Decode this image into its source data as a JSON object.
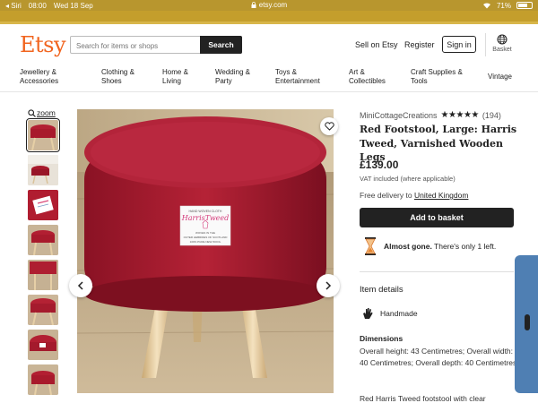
{
  "status": {
    "carrier": "◂ Siri",
    "time": "08:00",
    "date": "Wed 18 Sep",
    "url": "etsy.com",
    "battery": "71%",
    "battery_level": 0.71
  },
  "header": {
    "logo": "Etsy",
    "search_placeholder": "Search for items or shops",
    "search_button": "Search",
    "sell": "Sell on Etsy",
    "register": "Register",
    "signin": "Sign in",
    "basket": "Basket"
  },
  "categories": [
    [
      "Jewellery &",
      "Accessories"
    ],
    [
      "Clothing &",
      "Shoes"
    ],
    [
      "Home &",
      "Living"
    ],
    [
      "Wedding &",
      "Party"
    ],
    [
      "Toys &",
      "Entertainment"
    ],
    [
      "Art &",
      "Collectibles"
    ],
    [
      "Craft Supplies &",
      "Tools"
    ],
    [
      "Vintage",
      ""
    ]
  ],
  "gallery": {
    "zoom": "zoom",
    "thumb_count": 8,
    "label_lines": [
      "HAND WOVEN CLOTH",
      "HarrisTweed",
      "WOVEN IN THE",
      "OUTER HEBRIDES OF SCOTLAND",
      "100% PURE NEW WOOL"
    ]
  },
  "product": {
    "shop": "MiniCottageCreations",
    "rating_stars": "★★★★★",
    "rating": 5,
    "reviews": "(194)",
    "title": "Red Footstool, Large: Harris Tweed, Varnished Wooden Legs",
    "price": "£139.00",
    "vat": "VAT included (where applicable)",
    "delivery_prefix": "Free delivery to ",
    "delivery_country": "United Kingdom",
    "add_to_basket": "Add to basket",
    "almost_gone": "Almost gone.",
    "almost_gone_detail": " There's only 1 left.",
    "item_details": "Item details",
    "handmade": "Handmade",
    "dimensions_heading": "Dimensions",
    "dimensions": "Overall height: 43 Centimetres; Overall width: 40 Centimetres; Overall depth: 40 Centimetres",
    "description": "Red Harris Tweed footstool with clear"
  }
}
